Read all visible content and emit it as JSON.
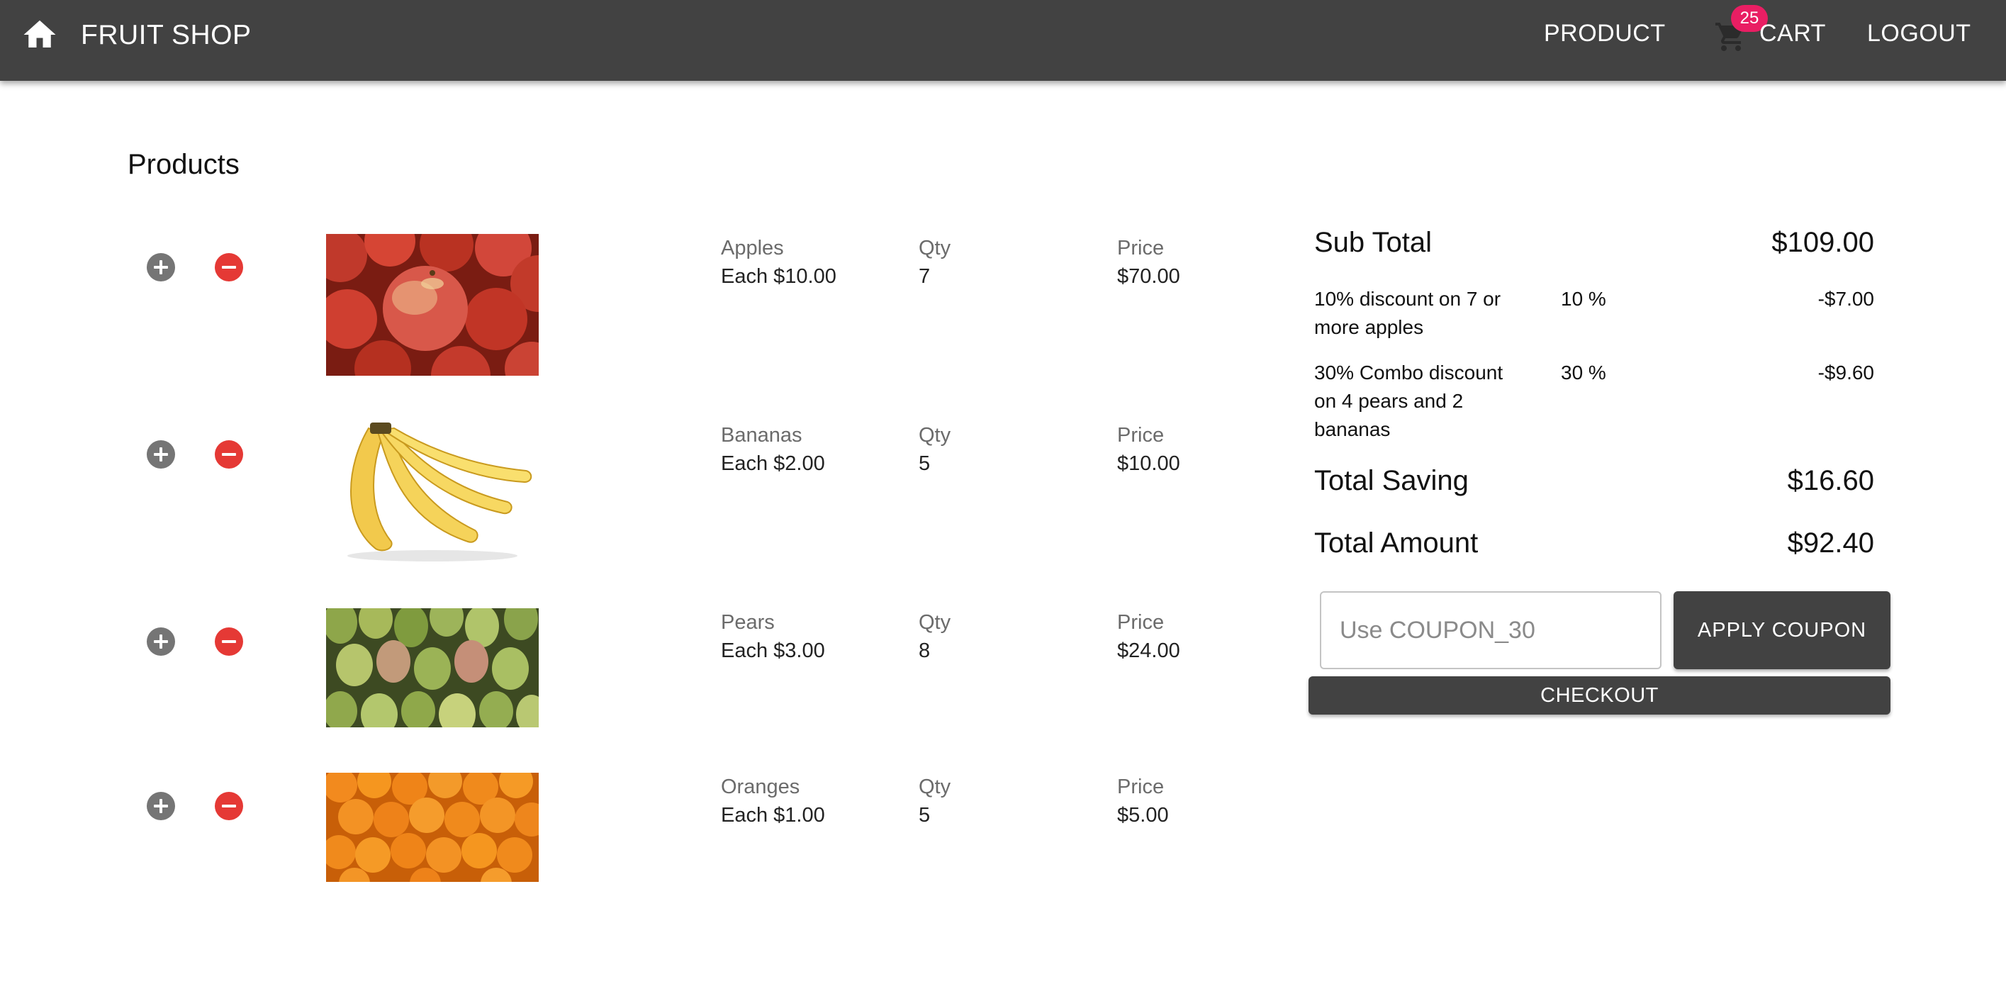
{
  "app": {
    "title": "FRUIT SHOP",
    "nav": {
      "product": "PRODUCT",
      "cart": "CART",
      "cart_count": "25",
      "logout": "LOGOUT"
    },
    "colors": {
      "appbar": "#424242",
      "badge": "#e91e63",
      "minus_button": "#e53935",
      "plus_button": "#757575"
    }
  },
  "products": {
    "heading": "Products",
    "items": [
      {
        "name": "Apples",
        "each": "Each $10.00",
        "qty_label": "Qty",
        "qty": "7",
        "price_label": "Price",
        "price": "$70.00",
        "image": "apples-photo"
      },
      {
        "name": "Bananas",
        "each": "Each $2.00",
        "qty_label": "Qty",
        "qty": "5",
        "price_label": "Price",
        "price": "$10.00",
        "image": "bananas-photo"
      },
      {
        "name": "Pears",
        "each": "Each $3.00",
        "qty_label": "Qty",
        "qty": "8",
        "price_label": "Price",
        "price": "$24.00",
        "image": "pears-photo"
      },
      {
        "name": "Oranges",
        "each": "Each $1.00",
        "qty_label": "Qty",
        "qty": "5",
        "price_label": "Price",
        "price": "$5.00",
        "image": "oranges-photo"
      }
    ]
  },
  "summary": {
    "subtotal_label": "Sub Total",
    "subtotal_value": "$109.00",
    "discounts": [
      {
        "description": "10% discount on 7 or more apples",
        "percent": "10 %",
        "amount": "-$7.00"
      },
      {
        "description": "30% Combo discount on 4 pears and 2 bananas",
        "percent": "30 %",
        "amount": "-$9.60"
      }
    ],
    "total_saving_label": "Total Saving",
    "total_saving_value": "$16.60",
    "total_amount_label": "Total Amount",
    "total_amount_value": "$92.40",
    "coupon_placeholder": "Use COUPON_30",
    "apply_label": "APPLY COUPON",
    "checkout_label": "CHECKOUT"
  }
}
